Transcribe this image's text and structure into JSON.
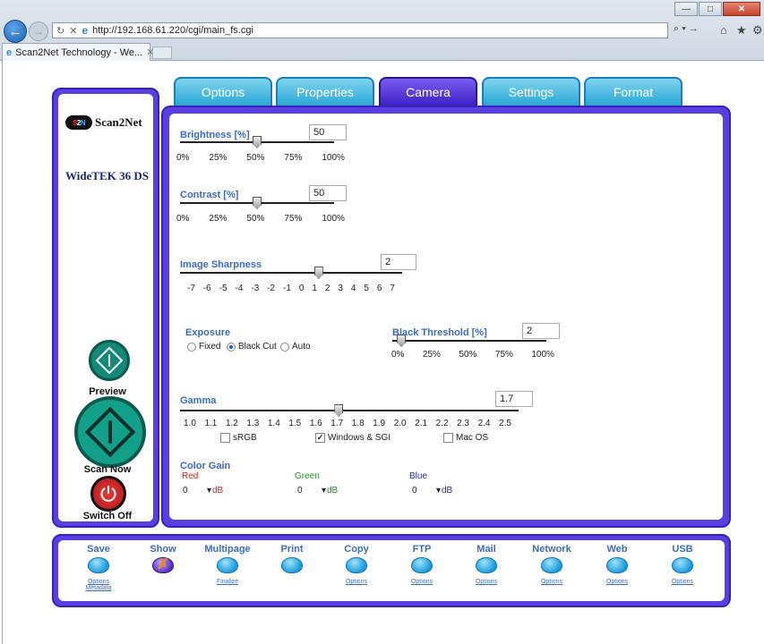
{
  "browser": {
    "url": "http://192.168.61.220/cgi/main_fs.cgi",
    "tab_title": "Scan2Net Technology - We...",
    "search_label": "⌕ ▾ →"
  },
  "tabs": [
    {
      "label": "Options"
    },
    {
      "label": "Properties"
    },
    {
      "label": "Camera"
    },
    {
      "label": "Settings"
    },
    {
      "label": "Format"
    }
  ],
  "sidebar": {
    "logo_mark": "S2N",
    "logo_text": "Scan2Net",
    "model": "WideTEK 36 DS",
    "preview_label": "Preview",
    "scan_label": "Scan Now",
    "off_label": "Switch Off"
  },
  "camera": {
    "brightness": {
      "label": "Brightness [%]",
      "value": "50",
      "ticks": [
        "0%",
        "25%",
        "50%",
        "75%",
        "100%"
      ],
      "level": 0.5
    },
    "contrast": {
      "label": "Contrast [%]",
      "value": "50",
      "ticks": [
        "0%",
        "25%",
        "50%",
        "75%",
        "100%"
      ],
      "level": 0.5
    },
    "sharpness": {
      "label": "Image Sharpness",
      "value": "2",
      "ticks": [
        "-7",
        "-6",
        "-5",
        "-4",
        "-3",
        "-2",
        "-1",
        "0",
        "1",
        "2",
        "3",
        "4",
        "5",
        "6",
        "7"
      ],
      "level": 0.6429
    },
    "exposure": {
      "label": "Exposure",
      "options": [
        "Fixed",
        "Black Cut",
        "Auto"
      ],
      "selected": "Black Cut"
    },
    "black_threshold": {
      "label": "Black Threshold [%]",
      "value": "2",
      "ticks": [
        "0%",
        "25%",
        "50%",
        "75%",
        "100%"
      ],
      "level": 0.02
    },
    "gamma": {
      "label": "Gamma",
      "value": "1.7",
      "ticks": [
        "1.0",
        "1.1",
        "1.2",
        "1.3",
        "1.4",
        "1.5",
        "1.6",
        "1.7",
        "1.8",
        "1.9",
        "2.0",
        "2.1",
        "2.2",
        "2.3",
        "2.4",
        "2.5"
      ],
      "level": 0.4667
    },
    "gamma_profiles": [
      {
        "label": "sRGB",
        "checked": false
      },
      {
        "label": "Windows & SGI",
        "checked": true
      },
      {
        "label": "Mac OS",
        "checked": false
      }
    ],
    "color_gain": {
      "label": "Color Gain",
      "red": {
        "label": "Red",
        "value": "0",
        "unit": "dB",
        "color": "#d42020"
      },
      "green": {
        "label": "Green",
        "value": "0",
        "unit": "dB",
        "color": "#1f9a1f"
      },
      "blue": {
        "label": "Blue",
        "value": "0",
        "unit": "dB",
        "color": "#2a2a9a"
      }
    }
  },
  "footer": [
    {
      "label": "Save",
      "sub": "Options",
      "sub2": "Metadata"
    },
    {
      "label": "Show",
      "sub": "",
      "sub2": ""
    },
    {
      "label": "Multipage",
      "sub": "Finalize",
      "sub2": ""
    },
    {
      "label": "Print",
      "sub": "",
      "sub2": ""
    },
    {
      "label": "Copy",
      "sub": "Options",
      "sub2": ""
    },
    {
      "label": "FTP",
      "sub": "Options",
      "sub2": ""
    },
    {
      "label": "Mail",
      "sub": "Options",
      "sub2": ""
    },
    {
      "label": "Network",
      "sub": "Options",
      "sub2": ""
    },
    {
      "label": "Web",
      "sub": "Options",
      "sub2": ""
    },
    {
      "label": "USB",
      "sub": "Options",
      "sub2": ""
    }
  ]
}
